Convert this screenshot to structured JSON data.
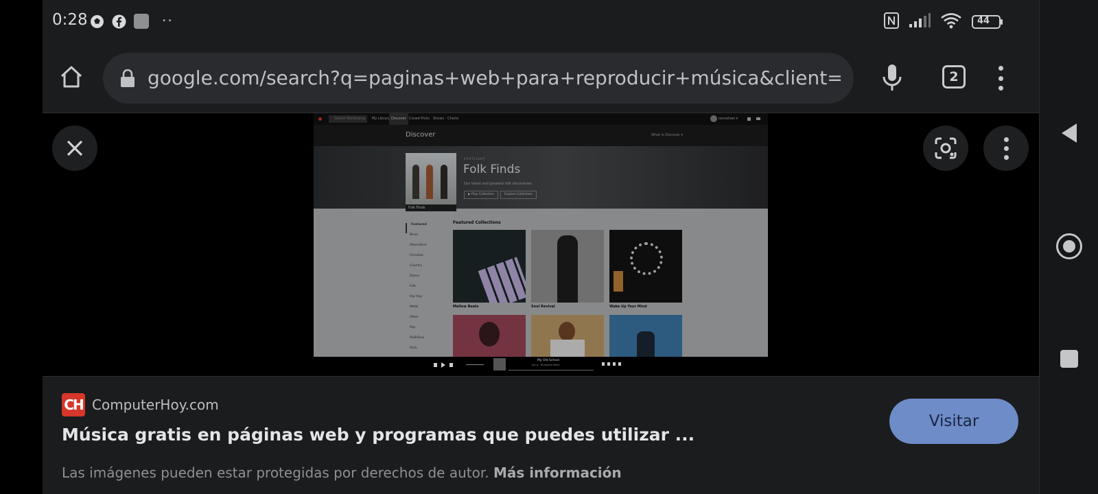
{
  "status_bar": {
    "time": "0:28",
    "dots": "··",
    "battery": "44",
    "icons": [
      "soccer-ball-icon",
      "facebook-icon",
      "app-icon",
      "nfc-icon",
      "signal-icon",
      "wifi-icon",
      "battery-icon"
    ]
  },
  "browser": {
    "url": "google.com/search?q=paginas+web+para+reproducir+música&client=ms-anc",
    "tab_count": "2"
  },
  "preview": {
    "top_nav": [
      "Search Bandcamp",
      "My Library",
      "Discover",
      "Crowd Picks",
      "Shows",
      "Charts"
    ],
    "user_name": "ourselves ▾",
    "discover_title": "Discover",
    "what_is_discover": "What is Discover ▾",
    "spotlight_kicker": "SPOTLIGHT",
    "hero_title": "Folk Finds",
    "hero_subtitle": "Our latest and greatest folk discoveries.",
    "art_label": "Folk Finds",
    "play_button": "▶ Play Collection",
    "explore_button": "Explore Collection",
    "genres": [
      "Featured",
      "Blues",
      "Alternative",
      "Christian",
      "Country",
      "Dance",
      "Folk",
      "Hip Hop",
      "Metal",
      "Other",
      "Pop",
      "R&B/Soul",
      "Rock"
    ],
    "featured_heading": "Featured Collections",
    "collections": [
      "Mellow Beats",
      "Soul Revival",
      "Wake Up Your Mind"
    ],
    "player_title": "My Old School",
    "player_artist": "Jenny · Bluegrass Band"
  },
  "info": {
    "site_logo": "CH",
    "site_name": "ComputerHoy.com",
    "title": "Música gratis en páginas web y programas que puedes utilizar ...",
    "visit_label": "Visitar",
    "copyright_text": "Las imágenes pueden estar protegidas por derechos de autor.",
    "more_info": "Más información"
  },
  "colors": {
    "visit_button": "#6e8cc8",
    "site_logo": "#d6372a",
    "background": "#1b1c1e"
  }
}
